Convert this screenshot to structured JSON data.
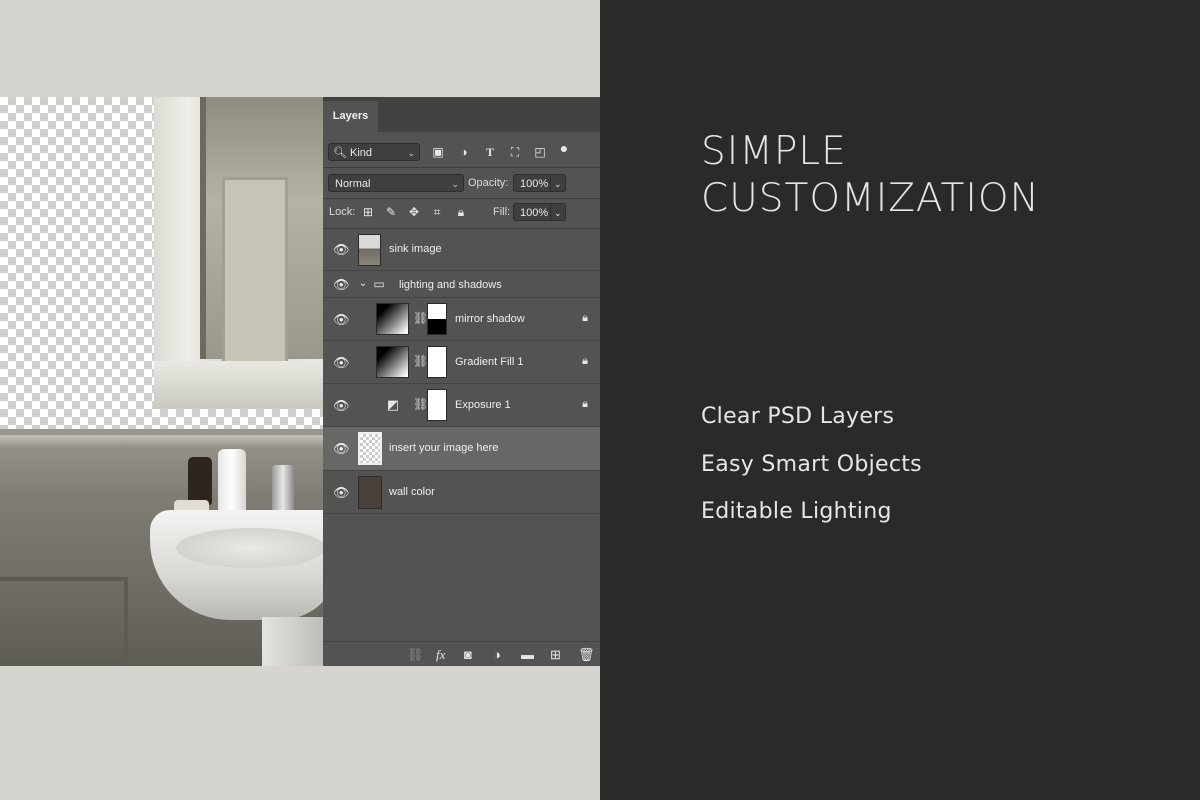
{
  "headline": {
    "line1": "SIMPLE",
    "line2": "CUSTOMIZATION"
  },
  "features": [
    "Clear PSD Layers",
    "Easy Smart Objects",
    "Editable Lighting"
  ],
  "layers_panel": {
    "tab_label": "Layers",
    "filter_label": "Kind",
    "blend_mode": "Normal",
    "opacity_label": "Opacity:",
    "opacity_value": "100%",
    "lock_label": "Lock:",
    "fill_label": "Fill:",
    "fill_value": "100%",
    "layers": [
      {
        "name": "sink image",
        "type": "smart-object"
      },
      {
        "name": "lighting and shadows",
        "type": "group",
        "expanded": true
      },
      {
        "name": "mirror shadow",
        "type": "gradient-fill",
        "locked": true
      },
      {
        "name": "Gradient Fill 1",
        "type": "gradient-fill",
        "locked": true
      },
      {
        "name": "Exposure 1",
        "type": "adjustment",
        "locked": true
      },
      {
        "name": "insert your image here",
        "type": "smart-object",
        "selected": true
      },
      {
        "name": "wall color",
        "type": "smart-object"
      }
    ],
    "footer_icons": [
      "link-icon",
      "fx-icon",
      "mask-icon",
      "adjustment-icon",
      "folder-icon",
      "new-layer-icon",
      "trash-icon"
    ]
  },
  "colors": {
    "panel_bg": "#535353",
    "right_bg": "#2a2a2a",
    "left_bg": "#d5d4cf",
    "selected_row": "#676767"
  }
}
